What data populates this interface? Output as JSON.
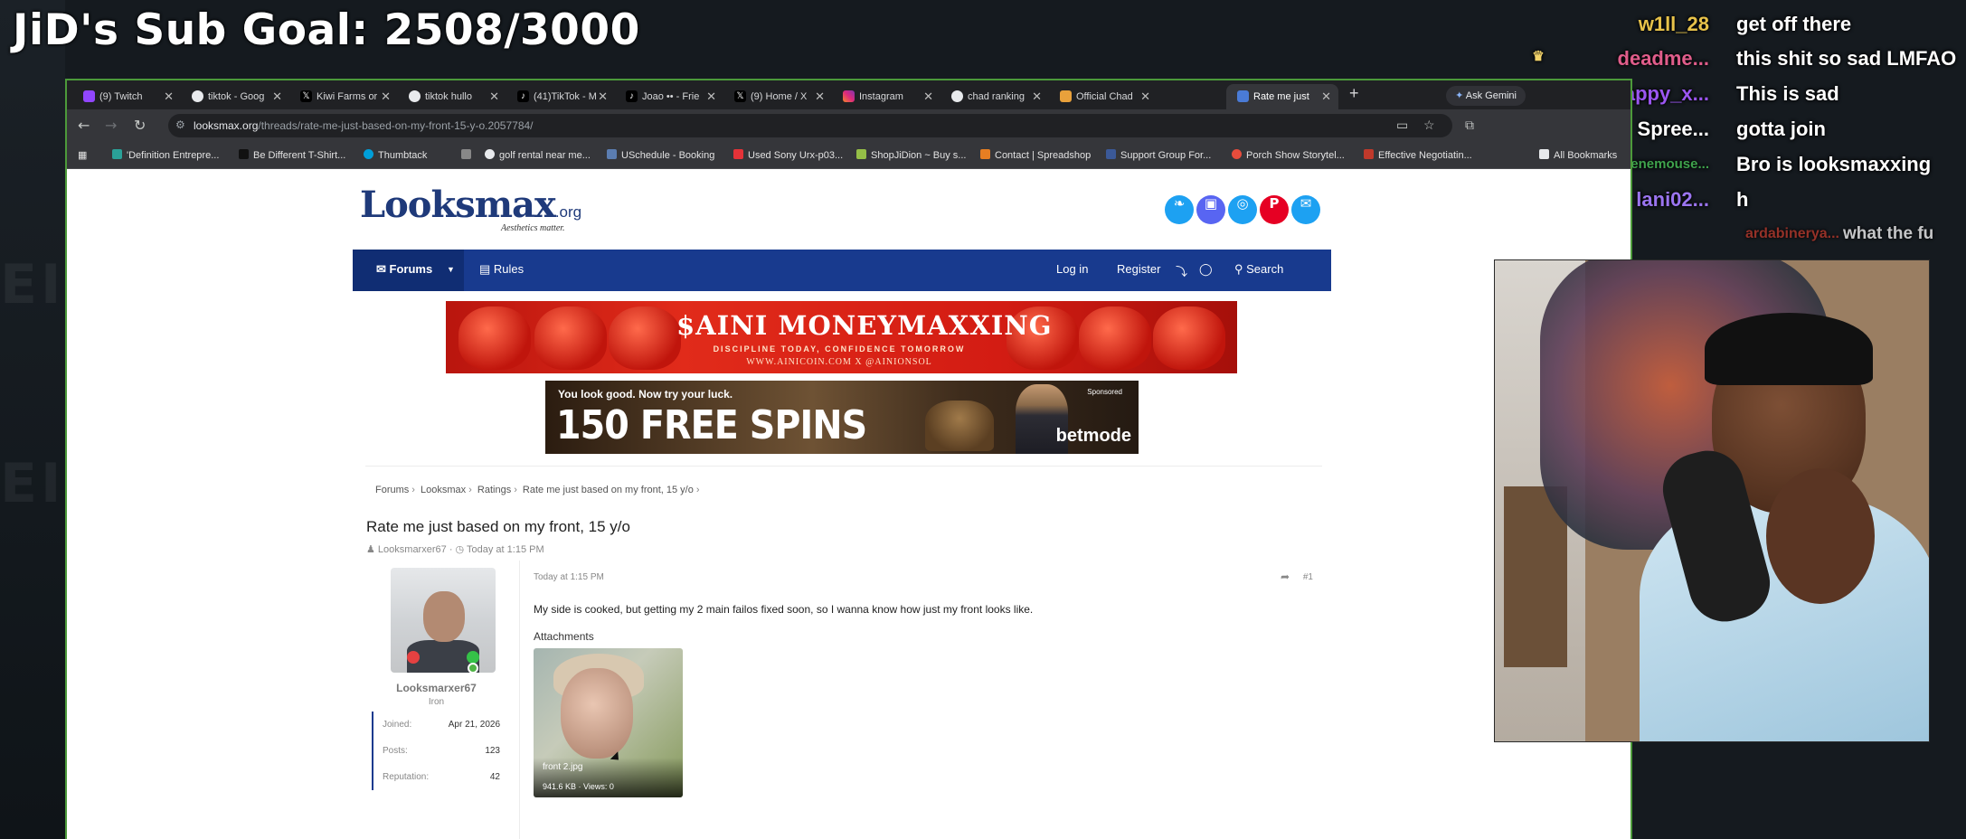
{
  "stream": {
    "sub_goal": "JiD's Sub Goal: 2508/3000"
  },
  "chat": [
    {
      "user": "w1ll_28",
      "user_color": "#e7c24a",
      "message": "get off there"
    },
    {
      "user": "deadme...",
      "user_color": "#e05d8b",
      "message": "this shit so sad LMFAO"
    },
    {
      "user": "appy_x...",
      "user_color": "#9b56f2",
      "message": "This is sad"
    },
    {
      "user": "Spree...",
      "user_color": "#ffffff",
      "message": "gotta join"
    },
    {
      "user": "venemouse...",
      "user_color": "#3fa34d",
      "message": "Bro is looksmaxxing"
    },
    {
      "user": "lani02...",
      "user_color": "#9b75f0",
      "message": "h"
    },
    {
      "user": "ardabinerya...",
      "user_color": "#c0392b",
      "message": "what the fu"
    }
  ],
  "browser": {
    "tabs": [
      {
        "title": "(9) Twitch",
        "icon": "twitch-icon",
        "color": "#9146ff"
      },
      {
        "title": "tiktok - Goog",
        "icon": "google-icon",
        "color": "#e8eaed"
      },
      {
        "title": "Kiwi Farms or",
        "icon": "x-icon",
        "color": "#e8eaed"
      },
      {
        "title": "tiktok hullo",
        "icon": "google-icon",
        "color": "#e8eaed"
      },
      {
        "title": "(41)TikTok - M",
        "icon": "tiktok-icon",
        "color": "#e8eaed"
      },
      {
        "title": "Joao •• - Frie",
        "icon": "tiktok-icon",
        "color": "#e8eaed"
      },
      {
        "title": "(9) Home / X",
        "icon": "x-icon",
        "color": "#e8eaed"
      },
      {
        "title": "Instagram",
        "icon": "instagram-icon",
        "color": "#e4405f"
      },
      {
        "title": "chad ranking",
        "icon": "google-icon",
        "color": "#e8eaed"
      },
      {
        "title": "Official Chad",
        "icon": "site-icon",
        "color": "#e9a13b"
      },
      {
        "title": "Rate me just",
        "icon": "looksmax-icon",
        "color": "#4a7bd6",
        "active": true
      }
    ],
    "ask_gemini": "Ask Gemini",
    "url_host": "looksmax.org",
    "url_path": "/threads/rate-me-just-based-on-my-front-15-y-o.2057784/",
    "bookmarks": [
      {
        "label": "'Definition Entrepre...",
        "color": "#2aa198"
      },
      {
        "label": "Be Different T-Shirt...",
        "color": "#111111"
      },
      {
        "label": "Thumbtack",
        "color": "#009fd9"
      },
      {
        "label": "",
        "color": "#888888"
      },
      {
        "label": "golf rental near me...",
        "color": "#e8eaed"
      },
      {
        "label": "USchedule - Booking",
        "color": "#5b7db1"
      },
      {
        "label": "Used Sony Urx-p03...",
        "color": "#e53238"
      },
      {
        "label": "ShopJiDion ~ Buy s...",
        "color": "#95bf47"
      },
      {
        "label": "Contact | Spreadshop",
        "color": "#e67e22"
      },
      {
        "label": "Support Group For...",
        "color": "#3b5998"
      },
      {
        "label": "Porch Show Storytel...",
        "color": "#e74c3c"
      },
      {
        "label": "Effective Negotiatin...",
        "color": "#c0392b"
      },
      {
        "label": "All Bookmarks",
        "color": "#e8eaed"
      }
    ]
  },
  "site": {
    "logo_text": "Looksmax",
    "logo_tld": ".org",
    "logo_tagline": "Aesthetics matter.",
    "social": [
      {
        "icon": "twitter-icon",
        "color": "#1da1f2",
        "glyph": "❧"
      },
      {
        "icon": "discord-icon",
        "color": "#5865f2",
        "glyph": "▣"
      },
      {
        "icon": "instagram-icon",
        "color": "#1da1f2",
        "glyph": "◎"
      },
      {
        "icon": "pinterest-icon",
        "color": "#e60023",
        "glyph": "P"
      },
      {
        "icon": "email-icon",
        "color": "#1da1f2",
        "glyph": "✉"
      }
    ],
    "nav": {
      "forums": "Forums",
      "rules": "Rules",
      "login": "Log in",
      "register": "Register",
      "search": "Search"
    },
    "ad1": {
      "title": "$AINI MONEYMAXXING",
      "tagline": "DISCIPLINE TODAY, CONFIDENCE TOMORROW",
      "links": "WWW.AINICOIN.COM   X @AINIONSOL"
    },
    "ad2": {
      "line1": "You look good. Now try your luck.",
      "line2": "150 FREE SPINS",
      "sponsored": "Sponsored",
      "brand": "betmode"
    },
    "breadcrumb": [
      "Forums",
      "Looksmax",
      "Ratings",
      "Rate me just based on my front, 15 y/o"
    ],
    "thread": {
      "title": "Rate me just based on my front, 15 y/o",
      "author": "Looksmarxer67",
      "date": "Today at 1:15 PM"
    },
    "user": {
      "name": "Looksmarxer67",
      "rank": "Iron",
      "stats": [
        {
          "label": "Joined:",
          "value": "Apr 21, 2026"
        },
        {
          "label": "Posts:",
          "value": "123"
        },
        {
          "label": "Reputation:",
          "value": "42"
        }
      ]
    },
    "post": {
      "date": "Today at 1:15 PM",
      "number": "#1",
      "body": "My side is cooked, but getting my 2 main failos fixed soon, so I wanna know how just my front looks like.",
      "attachments_heading": "Attachments",
      "attachment_name": "front 2.jpg",
      "attachment_meta": "941.6 KB · Views: 0"
    }
  }
}
